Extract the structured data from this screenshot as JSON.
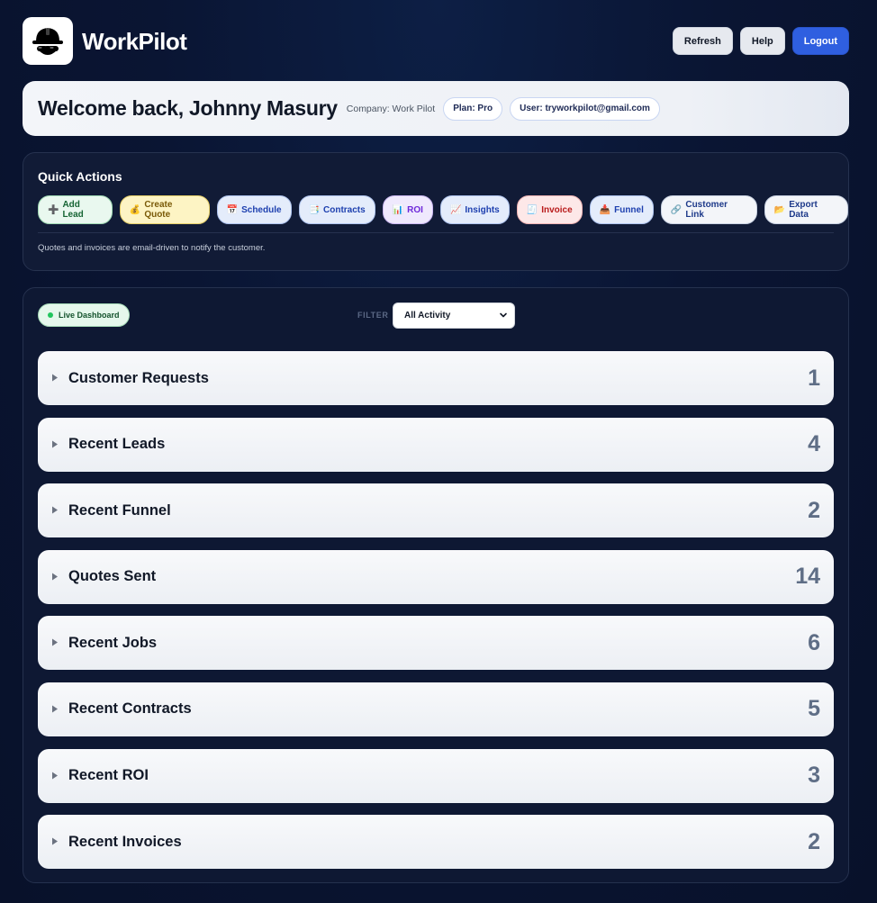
{
  "header": {
    "brand": "WorkPilot",
    "logo_icon": "hardhat-sunglasses-icon",
    "buttons": {
      "refresh": "Refresh",
      "help": "Help",
      "logout": "Logout"
    },
    "accent": "#2f5fe0"
  },
  "welcome": {
    "greeting": "Welcome back, Johnny Masury",
    "company": "Company: Work Pilot",
    "plan": "Plan: Pro",
    "user": "User: tryworkpilot@gmail.com"
  },
  "quick_actions": {
    "title": "Quick Actions",
    "buttons": [
      {
        "icon": "➕",
        "label": "Add Lead"
      },
      {
        "icon": "💰",
        "label": "Create Quote"
      },
      {
        "icon": "📅",
        "label": "Schedule"
      },
      {
        "icon": "📑",
        "label": "Contracts"
      },
      {
        "icon": "📊",
        "label": "ROI"
      },
      {
        "icon": "📈",
        "label": "Insights"
      },
      {
        "icon": "🧾",
        "label": "Invoice"
      },
      {
        "icon": "📥",
        "label": "Funnel"
      },
      {
        "icon": "🔗",
        "label": "Customer Link"
      },
      {
        "icon": "📂",
        "label": "Export Data"
      }
    ],
    "note": "Quotes and invoices are email-driven to notify the customer."
  },
  "dashboard": {
    "live_label": "Live Dashboard",
    "filter_label": "FILTER",
    "filter_value": "All Activity",
    "sections": [
      {
        "title": "Customer Requests",
        "count": "1"
      },
      {
        "title": "Recent Leads",
        "count": "4"
      },
      {
        "title": "Recent Funnel",
        "count": "2"
      },
      {
        "title": "Quotes Sent",
        "count": "14"
      },
      {
        "title": "Recent Jobs",
        "count": "6"
      },
      {
        "title": "Recent Contracts",
        "count": "5"
      },
      {
        "title": "Recent ROI",
        "count": "3"
      },
      {
        "title": "Recent Invoices",
        "count": "2"
      }
    ]
  }
}
